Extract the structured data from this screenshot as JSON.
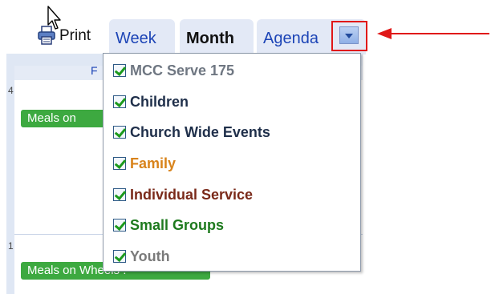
{
  "toolbar": {
    "print_label": "Print",
    "tabs": [
      {
        "label": "Week"
      },
      {
        "label": "Month"
      },
      {
        "label": "Agenda"
      }
    ],
    "active_tab": "Month"
  },
  "calendar": {
    "header_fragment": "F",
    "events": [
      "Meals on",
      "Meals on Wheels :"
    ],
    "tick_a": "4",
    "tick_b": "1"
  },
  "calendars_menu": {
    "items": [
      {
        "label": "MCC Serve 175",
        "checked": true,
        "color": "#6f7782"
      },
      {
        "label": "Children",
        "checked": true,
        "color": "#1f2f4a"
      },
      {
        "label": "Church Wide Events",
        "checked": true,
        "color": "#1f2f4a"
      },
      {
        "label": "Family",
        "checked": true,
        "color": "#d8831b"
      },
      {
        "label": "Individual Service",
        "checked": true,
        "color": "#7a2a1a"
      },
      {
        "label": "Small Groups",
        "checked": true,
        "color": "#1e7a1e"
      },
      {
        "label": "Youth",
        "checked": true,
        "color": "#7a7a7a"
      }
    ]
  },
  "colors": {
    "tab_bg": "#e3e9f6",
    "link_blue": "#1c44b6",
    "event_green": "#3da940",
    "annotation_red": "#e01818"
  },
  "icons": [
    "printer-icon",
    "dropdown-arrow-icon",
    "mouse-cursor-icon",
    "checkbox-checked-icon"
  ]
}
